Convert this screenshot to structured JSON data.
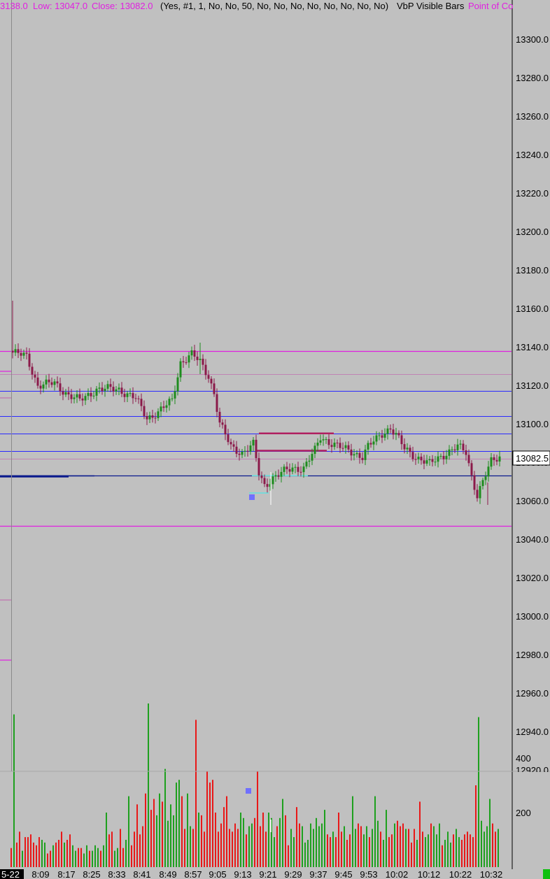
{
  "header": {
    "high_fragment": "3138.0",
    "low_label": "Low: 13047.0",
    "close_label": "Close: 13082.0",
    "params": "(Yes, #1, 1, No, No, 50, No, No, No, No, No, No, No, No)",
    "study_name": "VbP Visible Bars",
    "study2_fragment": "Point of Co"
  },
  "colors": {
    "background": "#c0c0c0",
    "up": "#1e8c1e",
    "down": "#8b1a4a",
    "magenta": "#e020e0",
    "blue": "#2a2aff",
    "navy": "#0a1a8c",
    "vol_up": "#1ea01e",
    "vol_down": "#e81818"
  },
  "chart_data": [
    {
      "type": "candlestick",
      "price_axis": {
        "range": [
          12920,
          13310
        ],
        "ticks": [
          "13300.0",
          "13280.0",
          "13260.0",
          "13240.0",
          "13220.0",
          "13200.0",
          "13180.0",
          "13160.0",
          "13140.0",
          "13120.0",
          "13100.0",
          "13080.0",
          "13060.0",
          "13040.0",
          "13020.0",
          "13000.0",
          "12980.0",
          "12960.0",
          "12940.0",
          "12920.0"
        ],
        "current_price": "13082.5"
      },
      "time_axis": {
        "date_label": "5-22",
        "labels": [
          "8:09",
          "8:17",
          "8:25",
          "8:33",
          "8:41",
          "8:49",
          "8:57",
          "9:05",
          "9:13",
          "9:21",
          "9:29",
          "9:37",
          "9:45",
          "9:53",
          "10:02",
          "10:12",
          "10:22",
          "10:32"
        ]
      },
      "close_path": [
        [
          0,
          13137
        ],
        [
          5,
          13135
        ],
        [
          9,
          13120
        ],
        [
          15,
          13121
        ],
        [
          20,
          13115
        ],
        [
          24,
          13112
        ],
        [
          30,
          13118
        ],
        [
          38,
          13118
        ],
        [
          44,
          13113
        ],
        [
          48,
          13103
        ],
        [
          52,
          13106
        ],
        [
          57,
          13112
        ],
        [
          60,
          13132
        ],
        [
          64,
          13136
        ],
        [
          67,
          13132
        ],
        [
          70,
          13125
        ],
        [
          72,
          13116
        ],
        [
          74,
          13100
        ],
        [
          78,
          13088
        ],
        [
          82,
          13085
        ],
        [
          86,
          13089
        ],
        [
          88,
          13074
        ],
        [
          90,
          13068
        ],
        [
          93,
          13072
        ],
        [
          97,
          13075
        ],
        [
          100,
          13077
        ],
        [
          104,
          13077
        ],
        [
          108,
          13086
        ],
        [
          110,
          13093
        ],
        [
          114,
          13090
        ],
        [
          118,
          13087
        ],
        [
          122,
          13085
        ],
        [
          125,
          13083
        ],
        [
          127,
          13088
        ],
        [
          130,
          13092
        ],
        [
          132,
          13095
        ],
        [
          135,
          13098
        ],
        [
          137,
          13094
        ],
        [
          140,
          13087
        ],
        [
          144,
          13083
        ],
        [
          149,
          13079
        ],
        [
          152,
          13082
        ],
        [
          155,
          13085
        ],
        [
          159,
          13088
        ],
        [
          162,
          13085
        ],
        [
          164,
          13073
        ],
        [
          166,
          13063
        ],
        [
          168,
          13070
        ],
        [
          171,
          13080
        ],
        [
          174,
          13083
        ]
      ],
      "horizontal_levels": [
        {
          "price": 13138,
          "color": "magenta"
        },
        {
          "price": 13126,
          "color": "magenta_thin"
        },
        {
          "price": 13117,
          "color": "blue"
        },
        {
          "price": 13104,
          "color": "blue"
        },
        {
          "price": 13095,
          "color": "blue"
        },
        {
          "price": 13086,
          "color": "blue"
        },
        {
          "price": 13082,
          "color": "magenta_thin"
        },
        {
          "price": 13073,
          "color": "navy"
        },
        {
          "price": 13047,
          "color": "magenta"
        }
      ]
    },
    {
      "type": "bar",
      "name": "volume",
      "y_axis": {
        "ticks": [
          "400",
          "200"
        ],
        "range": [
          0,
          600
        ]
      },
      "values": [
        70,
        560,
        90,
        130,
        60,
        110,
        110,
        120,
        90,
        80,
        110,
        100,
        90,
        50,
        60,
        80,
        90,
        100,
        130,
        90,
        100,
        120,
        80,
        60,
        70,
        70,
        50,
        80,
        60,
        60,
        80,
        70,
        60,
        80,
        200,
        120,
        130,
        60,
        70,
        140,
        70,
        100,
        260,
        80,
        130,
        230,
        120,
        150,
        270,
        600,
        210,
        250,
        190,
        270,
        240,
        360,
        170,
        230,
        190,
        310,
        320,
        260,
        140,
        270,
        150,
        140,
        540,
        200,
        190,
        130,
        350,
        310,
        320,
        200,
        130,
        160,
        220,
        260,
        140,
        130,
        160,
        140,
        200,
        180,
        120,
        150,
        160,
        180,
        350,
        150,
        200,
        130,
        200,
        180,
        110,
        150,
        180,
        250,
        190,
        80,
        140,
        110,
        220,
        160,
        150,
        90,
        100,
        160,
        140,
        180,
        150,
        160,
        210,
        120,
        110,
        130,
        110,
        200,
        130,
        150,
        100,
        120,
        260,
        140,
        160,
        150,
        120,
        150,
        110,
        140,
        260,
        170,
        130,
        100,
        210,
        110,
        120,
        160,
        170,
        150,
        160,
        140,
        140,
        90,
        140,
        100,
        240,
        130,
        110,
        120,
        160,
        150,
        120,
        160,
        80,
        100,
        130,
        90,
        120,
        140,
        110,
        100,
        120,
        130,
        120,
        110,
        300,
        550,
        170,
        130,
        150,
        250,
        160,
        130,
        140
      ]
    }
  ]
}
